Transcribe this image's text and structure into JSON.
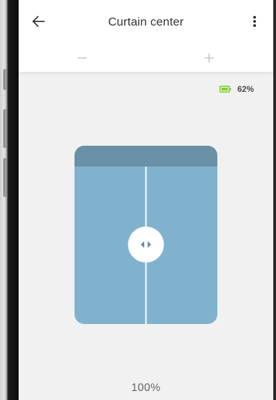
{
  "header": {
    "title": "Curtain center",
    "back_icon": "arrow-left-icon",
    "menu_icon": "more-vertical-icon"
  },
  "controls": {
    "decrease_icon": "minus-icon",
    "increase_icon": "plus-icon"
  },
  "battery": {
    "icon": "battery-icon",
    "level": "62%",
    "color": "#7ed321"
  },
  "curtain": {
    "handle_icon": "drag-horizontal-icon",
    "rail_color": "#6a90a6",
    "panel_color": "#81b2cd"
  },
  "position": {
    "value": "100%"
  }
}
